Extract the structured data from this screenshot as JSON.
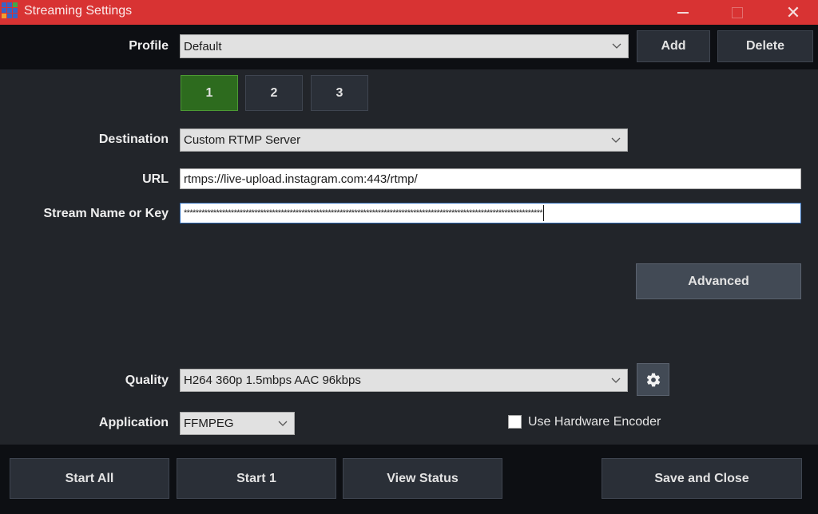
{
  "window": {
    "title": "Streaming Settings",
    "icon": "app-grid-icon",
    "icon_colors": [
      "#3a63c4",
      "#3a63c4",
      "#41a84a",
      "#3a63c4",
      "#3a63c4",
      "#3a63c4",
      "#f0a030",
      "#3a63c4",
      "#3a63c4"
    ],
    "controls": {
      "minimize": "minimize-icon",
      "maximize": "maximize-icon",
      "close": "close-icon",
      "close_glyph": "✕"
    }
  },
  "profile": {
    "label": "Profile",
    "value": "Default",
    "add_label": "Add",
    "delete_label": "Delete"
  },
  "tabs": [
    {
      "label": "1",
      "active": true
    },
    {
      "label": "2",
      "active": false
    },
    {
      "label": "3",
      "active": false
    }
  ],
  "form": {
    "destination": {
      "label": "Destination",
      "value": "Custom RTMP Server"
    },
    "url": {
      "label": "URL",
      "value": "rtmps://live-upload.instagram.com:443/rtmp/"
    },
    "stream_key": {
      "label": "Stream Name or Key",
      "value": "**************************************************************************************************************************"
    },
    "advanced_label": "Advanced",
    "quality": {
      "label": "Quality",
      "value": "H264 360p 1.5mbps AAC 96kbps",
      "settings_icon": "gear-icon"
    },
    "application": {
      "label": "Application",
      "value": "FFMPEG"
    },
    "hardware_encoder": {
      "label": "Use Hardware Encoder",
      "checked": false
    }
  },
  "footer": {
    "start_all_label": "Start All",
    "start_one_label": "Start 1",
    "view_status_label": "View Status",
    "save_close_label": "Save and Close"
  },
  "colors": {
    "titlebar": "#d83333",
    "active_tab": "#2d6b1e",
    "background": "#22252a"
  }
}
